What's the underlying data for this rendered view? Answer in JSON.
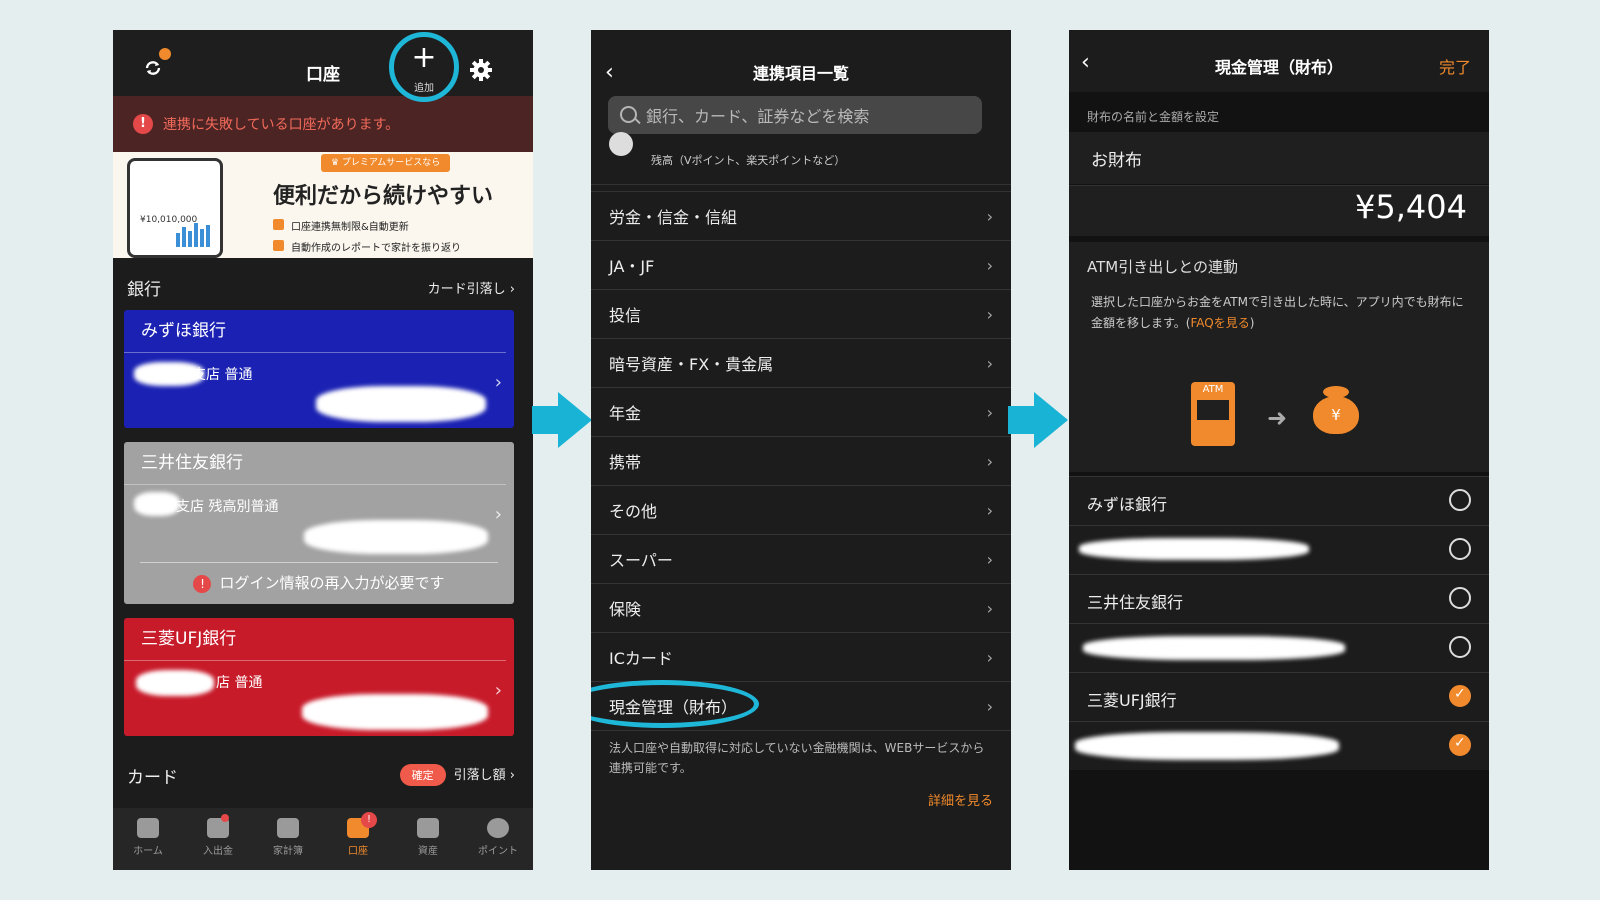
{
  "phone1": {
    "title": "口座",
    "add_label": "追加",
    "alert": "連携に失敗している口座があります。",
    "banner": {
      "badge": "♛ プレミアムサービスなら",
      "headline": "便利だから続けやすい",
      "feature1": "口座連携無制限&自動更新",
      "feature2": "自動作成のレポートで家計を振り返り",
      "amount": "¥10,010,000"
    },
    "bank_section": {
      "title": "銀行",
      "link": "カード引落し"
    },
    "banks": [
      {
        "name": "みずほ銀行",
        "branch": "支店 普通",
        "color": "#1b22b3"
      },
      {
        "name": "三井住友銀行",
        "branch": "支店 残高別普通",
        "color": "#a2a2a2",
        "warning": "ログイン情報の再入力が必要です"
      },
      {
        "name": "三菱UFJ銀行",
        "branch": "店 普通",
        "color": "#c81b2a"
      }
    ],
    "card_section": {
      "title": "カード",
      "badge": "確定",
      "link": "引落し額"
    },
    "tabs": [
      {
        "label": "ホーム"
      },
      {
        "label": "入出金"
      },
      {
        "label": "家計簿"
      },
      {
        "label": "口座",
        "badge": "!"
      },
      {
        "label": "資産"
      },
      {
        "label": "ポイント"
      }
    ]
  },
  "phone2": {
    "title": "連携項目一覧",
    "search_placeholder": "銀行、カード、証券などを検索",
    "partial_row": "残高（Vポイント、楽天ポイントなど）",
    "items": [
      "労金・信金・信組",
      "JA・JF",
      "投信",
      "暗号資産・FX・貴金属",
      "年金",
      "携帯",
      "その他",
      "スーパー",
      "保険",
      "ICカード",
      "現金管理（財布）"
    ],
    "note": "法人口座や自動取得に対応していない金融機関は、WEBサービスから連携可能です。",
    "detail_link": "詳細を見る"
  },
  "phone3": {
    "title": "現金管理（財布）",
    "done": "完了",
    "sub_label": "財布の名前と金額を設定",
    "wallet_name": "お財布",
    "amount": "¥5,404",
    "atm_title": "ATM引き出しとの連動",
    "atm_desc": "選択した口座からお金をATMで引き出した時に、アプリ内でも財布に金額を移します。(",
    "faq": "FAQを見る",
    "atm_desc_end": ")",
    "atm_icon_text": "ATM",
    "purse_text": "¥",
    "accounts": [
      {
        "name": "みずほ銀行",
        "checked": false
      },
      {
        "name": "",
        "checked": false
      },
      {
        "name": "三井住友銀行",
        "checked": false
      },
      {
        "name": "",
        "checked": false
      },
      {
        "name": "三菱UFJ銀行",
        "checked": true
      },
      {
        "name": "",
        "checked": true
      }
    ]
  },
  "colors": {
    "accent": "#f08a2c",
    "highlight_ring": "#1fb7d8",
    "alert": "#e54848"
  }
}
